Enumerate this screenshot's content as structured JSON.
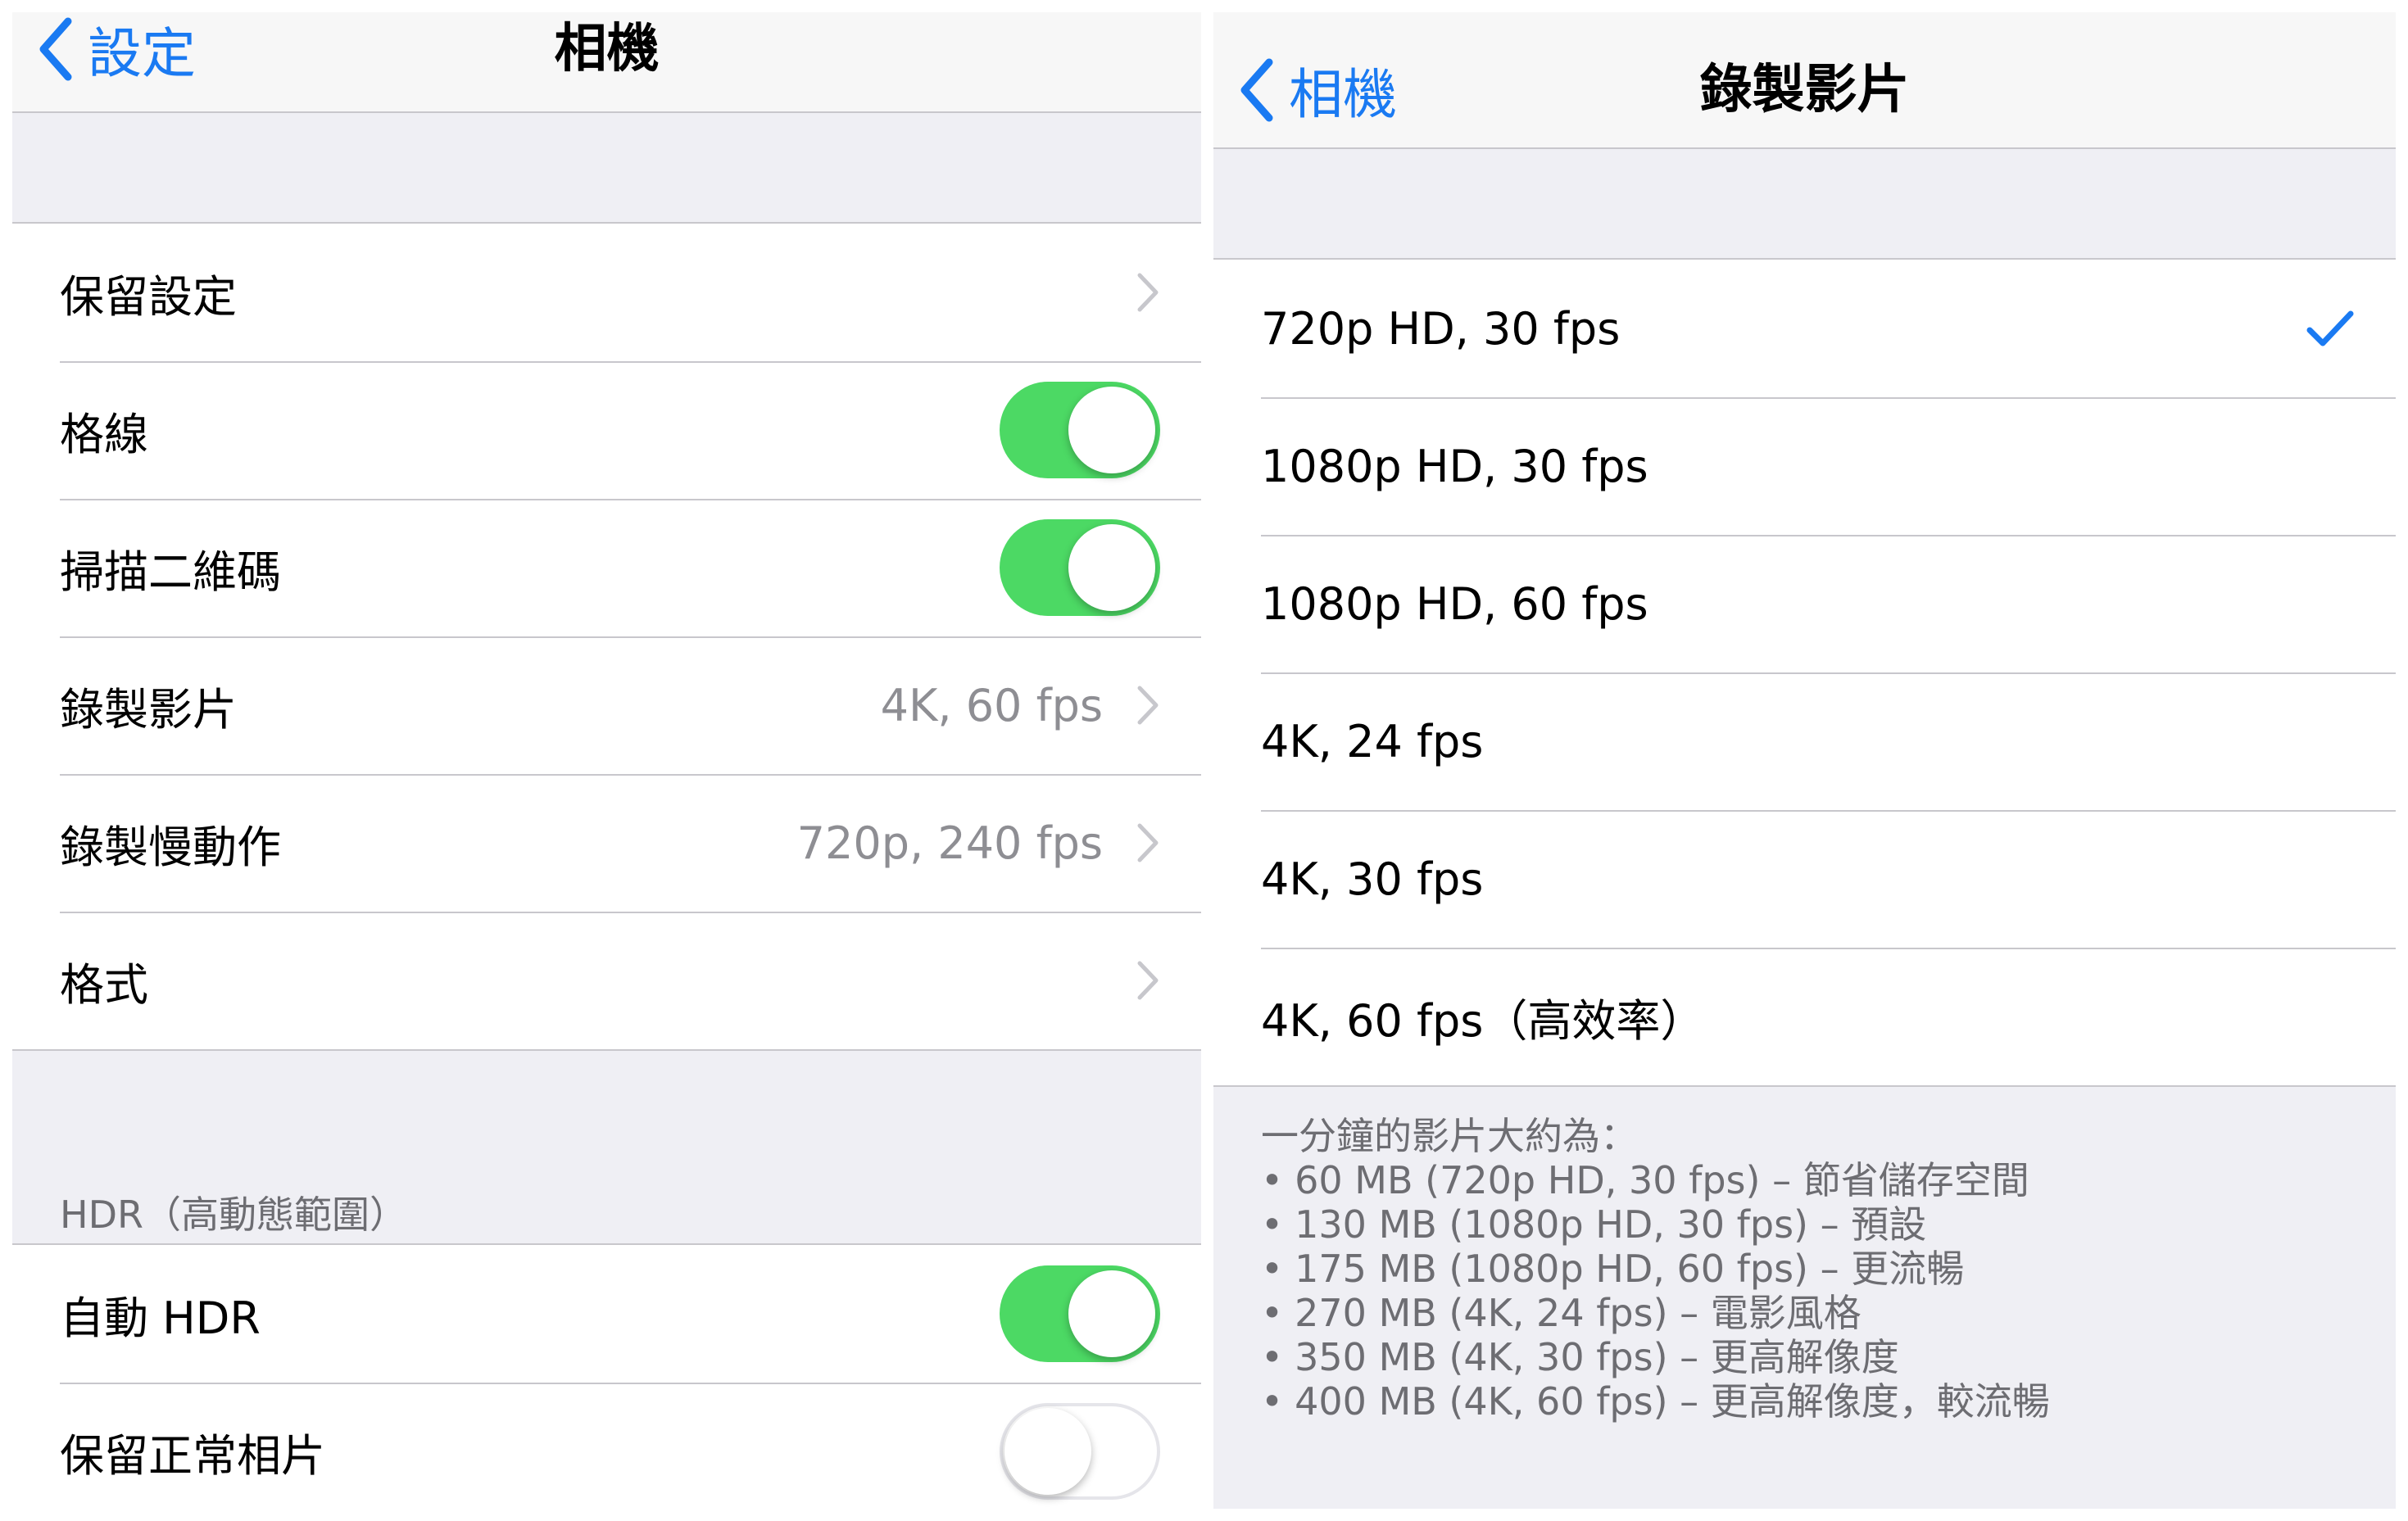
{
  "left": {
    "back_label": "設定",
    "title": "相機",
    "rows": [
      {
        "label": "保留設定",
        "value": ""
      },
      {
        "label": "格線",
        "toggle": true
      },
      {
        "label": "掃描二維碼",
        "toggle": true
      },
      {
        "label": "錄製影片",
        "value": "4K, 60 fps"
      },
      {
        "label": "錄製慢動作",
        "value": "720p, 240 fps"
      },
      {
        "label": "格式",
        "value": ""
      }
    ],
    "hdr_header": "HDR（高動態範圍）",
    "hdr_rows": [
      {
        "label": "自動 HDR",
        "toggle": true
      },
      {
        "label": "保留正常相片",
        "toggle": false
      }
    ]
  },
  "right": {
    "back_label": "相機",
    "title": "錄製影片",
    "selected_index": 0,
    "options": [
      "720p HD, 30 fps",
      "1080p HD, 30 fps",
      "1080p HD, 60 fps",
      "4K, 24 fps",
      "4K, 30 fps",
      "4K, 60 fps（高效率）"
    ],
    "footer_intro": "一分鐘的影片大約為：",
    "footer_items": [
      "60 MB (720p HD, 30 fps) – 節省儲存空間",
      "130 MB (1080p HD, 30 fps) – 預設",
      "175 MB (1080p HD, 60 fps) – 更流暢",
      "270 MB (4K, 24 fps) – 電影風格",
      "350 MB (4K, 30 fps) – 更高解像度",
      "400 MB (4K, 60 fps) – 更高解像度，較流暢"
    ]
  },
  "colors": {
    "accent": "#1a7af2",
    "toggle_on": "#4cd964",
    "grouped_background": "#efeff4",
    "separator": "#c8c7cc",
    "secondary_text": "#8e8e93"
  },
  "icons": {
    "back": "chevron-left-icon",
    "disclosure": "chevron-right-icon",
    "selected": "checkmark-icon"
  }
}
